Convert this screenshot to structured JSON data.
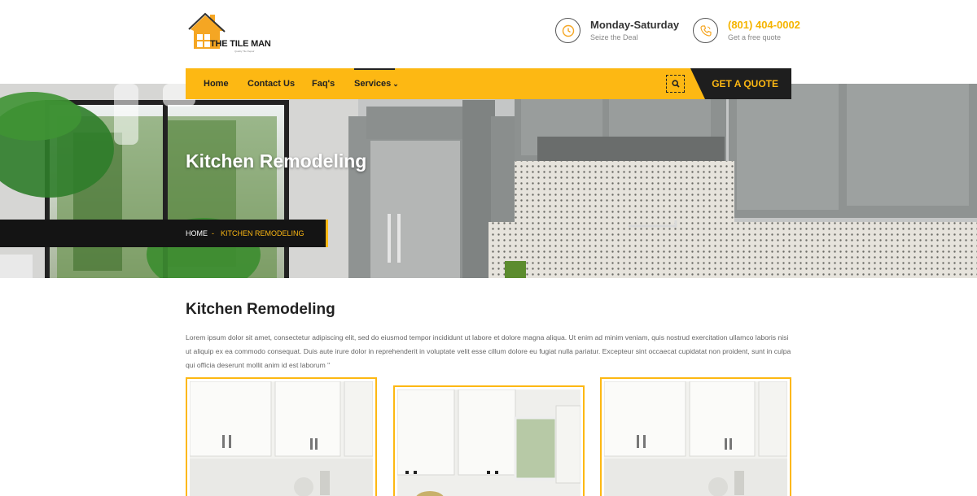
{
  "header": {
    "logo": {
      "text": "THE TILE MAN",
      "tagline": "Quality Tile Repair",
      "brand_color": "#f5a623"
    },
    "info": [
      {
        "icon": "clock-icon",
        "title": "Monday-Saturday",
        "subtitle": "Seize the Deal"
      },
      {
        "icon": "phone-icon",
        "title": "(801) 404-0002",
        "subtitle": "Get a free quote"
      }
    ]
  },
  "nav": {
    "items": [
      "Home",
      "Contact Us",
      "Faq's",
      "Services"
    ],
    "services_caret": "⌄",
    "search_icon": "search-icon",
    "quote_label": "GET A QUOTE",
    "bar_color": "#fdb813",
    "quote_bg": "#1e1e1e"
  },
  "hero": {
    "title": "Kitchen Remodeling",
    "breadcrumb": {
      "home": "HOME",
      "separator": "-",
      "current": "KITCHEN REMODELING"
    }
  },
  "content": {
    "title": "Kitchen Remodeling",
    "paragraph": "Lorem ipsum dolor sit amet, consectetur adipiscing elit, sed do eiusmod tempor incididunt ut labore et dolore magna aliqua. Ut enim ad minim veniam, quis nostrud exercitation ullamco laboris nisi ut aliquip ex ea commodo consequat. Duis aute irure dolor in reprehenderit in voluptate velit esse cillum dolore eu fugiat nulla pariatur. Excepteur sint occaecat cupidatat non proident, sunt in culpa qui officia deserunt mollit anim id est laborum \""
  },
  "colors": {
    "accent": "#fdb813",
    "dark": "#1e1e1e",
    "text": "#666666"
  }
}
